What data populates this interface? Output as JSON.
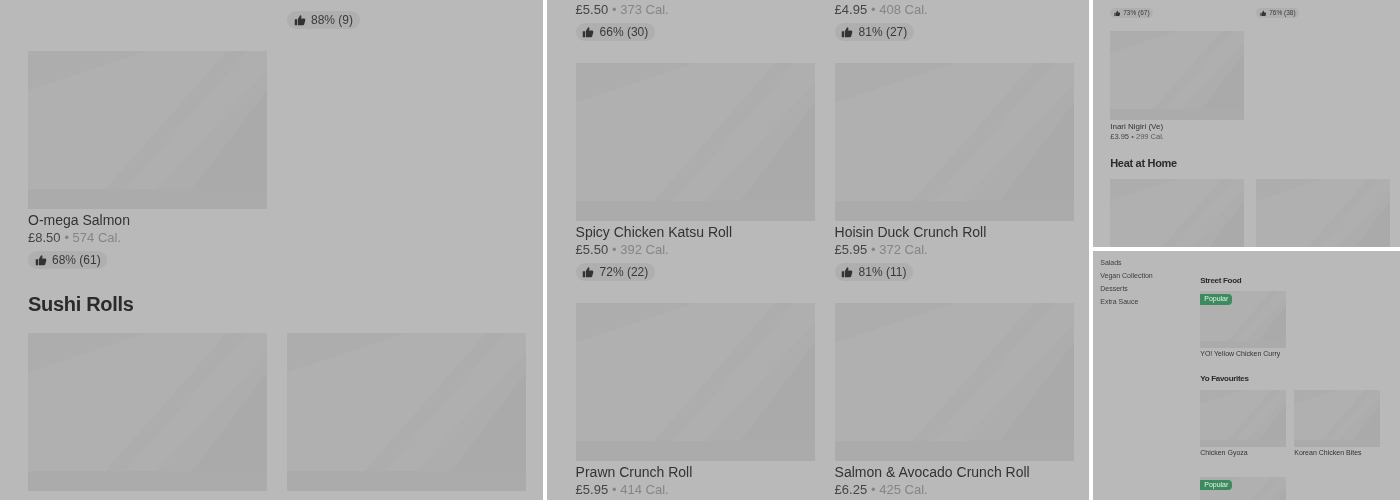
{
  "panels": [
    {
      "sections": [
        {
          "items": [
            {
              "kind": "blank"
            },
            {
              "kind": "info",
              "rating": "88% (9)"
            }
          ]
        },
        {
          "items": [
            {
              "kind": "picture",
              "name": "O-mega Salmon",
              "price": "£8.50",
              "calories": "• 574 Cal.",
              "rating": "68% (61)"
            }
          ]
        },
        {
          "title": "Sushi Rolls"
        }
      ]
    },
    {
      "sections": [
        {
          "items": [
            {
              "kind": "info",
              "price": "£5.50",
              "calories": "• 373 Cal.",
              "rating": "66% (30)"
            },
            {
              "kind": "info",
              "price": "£4.95",
              "calories": "• 408 Cal.",
              "rating": "81% (27)"
            }
          ]
        },
        {
          "items": [
            {
              "kind": "picture",
              "name": "Spicy Chicken Katsu Roll",
              "price": "£5.50",
              "calories": "• 392 Cal.",
              "rating": "72% (22)"
            },
            {
              "kind": "picture",
              "name": "Hoisin Duck Crunch Roll",
              "price": "£5.95",
              "calories": "• 372 Cal.",
              "rating": "81% (11)"
            },
            {
              "kind": "picture",
              "name": "Prawn Crunch Roll",
              "price": "£5.95",
              "calories": "• 414 Cal."
            },
            {
              "kind": "picture",
              "name": "Salmon & Avocado Crunch Roll",
              "price": "£6.25",
              "calories": "• 425 Cal."
            }
          ]
        }
      ]
    },
    {
      "sections": [
        {
          "items": [
            {
              "kind": "info",
              "rating": "73% (67)"
            },
            {
              "kind": "info",
              "rating": "76% (38)"
            }
          ]
        },
        {
          "items": [
            {
              "kind": "picture",
              "name": "Inari Nigiri (Ve)",
              "price": "£3.95",
              "calories": "• 299 Cal."
            }
          ]
        },
        {
          "title": "Heat at Home"
        }
      ]
    },
    {
      "sidebar": {
        "items": [
          {
            "label": "Salads"
          },
          {
            "label": "Vegan Collection"
          },
          {
            "label": "Desserts"
          },
          {
            "label": "Extra Sauce"
          }
        ]
      },
      "sections": [
        {
          "title": "Street Food",
          "items": [
            {
              "kind": "picture",
              "badge": "Popular",
              "name": "YO! Yellow Chicken Curry"
            }
          ]
        },
        {
          "title": "Yo Favourites",
          "items": [
            {
              "kind": "picture",
              "name": "Chicken Gyoza"
            },
            {
              "kind": "picture",
              "name": "Korean Chicken Bites"
            },
            {
              "kind": "picture",
              "badge": "Popular"
            }
          ]
        }
      ]
    }
  ]
}
